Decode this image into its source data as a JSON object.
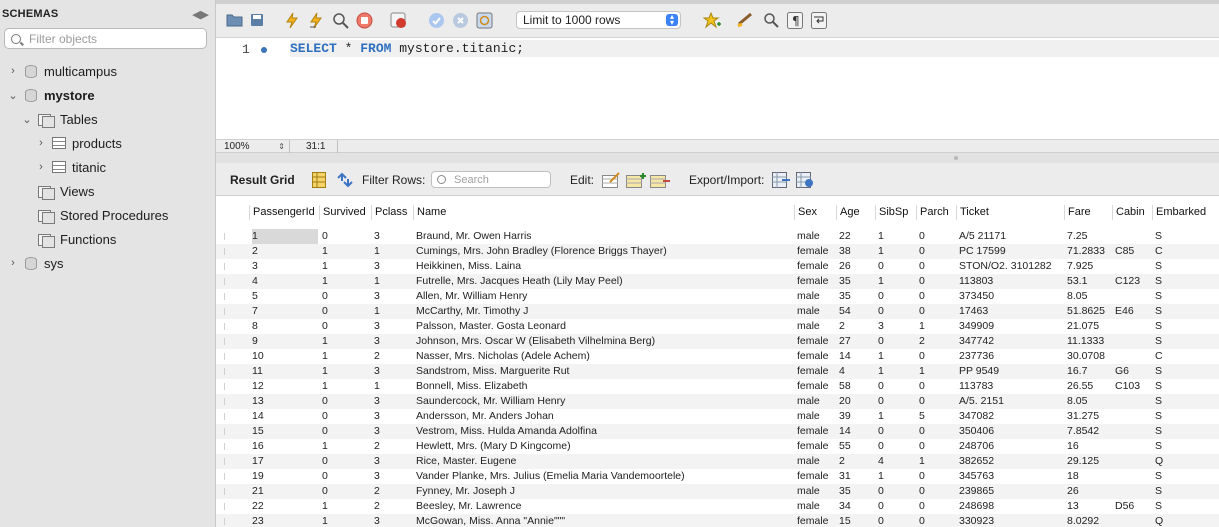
{
  "sidebar": {
    "title": "SCHEMAS",
    "search_placeholder": "Filter objects",
    "tree": [
      {
        "label": "multicampus",
        "chev": "›",
        "type": "db"
      },
      {
        "label": "mystore",
        "chev": "⌄",
        "type": "db"
      },
      {
        "label": "Tables",
        "chev": "⌄",
        "type": "folder"
      },
      {
        "label": "products",
        "chev": "›",
        "type": "table"
      },
      {
        "label": "titanic",
        "chev": "›",
        "type": "table"
      },
      {
        "label": "Views",
        "chev": "",
        "type": "folder"
      },
      {
        "label": "Stored Procedures",
        "chev": "",
        "type": "folder"
      },
      {
        "label": "Functions",
        "chev": "",
        "type": "folder"
      },
      {
        "label": "sys",
        "chev": "›",
        "type": "db"
      }
    ]
  },
  "toolbar": {
    "limit_label": "Limit to 1000 rows",
    "icons": [
      "open-folder-icon",
      "save-icon",
      "execute-icon",
      "execute-current-icon",
      "explain-icon",
      "stop-icon",
      "toggle-error-icon",
      "commit-icon",
      "rollback-icon",
      "autocommit-icon",
      "bookmark-icon",
      "beautify-icon",
      "find-icon",
      "invisible-chars-icon",
      "wrap-icon"
    ]
  },
  "editor": {
    "line_number": "1",
    "kw_select": "SELECT",
    "star": " * ",
    "kw_from": "FROM",
    "target": " mystore.titanic;"
  },
  "status": {
    "zoom": "100%",
    "cursor": "31:1"
  },
  "result_toolbar": {
    "result_grid_label": "Result Grid",
    "filter_label": "Filter Rows:",
    "search_placeholder": "Search",
    "edit_label": "Edit:",
    "export_label": "Export/Import:"
  },
  "grid": {
    "columns": [
      "PassengerId",
      "Survived",
      "Pclass",
      "Name",
      "Sex",
      "Age",
      "SibSp",
      "Parch",
      "Ticket",
      "Fare",
      "Cabin",
      "Embarked"
    ],
    "rows": [
      [
        "1",
        "0",
        "3",
        "Braund, Mr. Owen Harris",
        "male",
        "22",
        "1",
        "0",
        "A/5 21171",
        "7.25",
        "",
        "S"
      ],
      [
        "2",
        "1",
        "1",
        "Cumings, Mrs. John Bradley (Florence Briggs Thayer)",
        "female",
        "38",
        "1",
        "0",
        "PC 17599",
        "71.2833",
        "C85",
        "C"
      ],
      [
        "3",
        "1",
        "3",
        "Heikkinen, Miss. Laina",
        "female",
        "26",
        "0",
        "0",
        "STON/O2. 3101282",
        "7.925",
        "",
        "S"
      ],
      [
        "4",
        "1",
        "1",
        "Futrelle, Mrs. Jacques Heath (Lily May Peel)",
        "female",
        "35",
        "1",
        "0",
        "113803",
        "53.1",
        "C123",
        "S"
      ],
      [
        "5",
        "0",
        "3",
        "Allen, Mr. William Henry",
        "male",
        "35",
        "0",
        "0",
        "373450",
        "8.05",
        "",
        "S"
      ],
      [
        "7",
        "0",
        "1",
        "McCarthy, Mr. Timothy J",
        "male",
        "54",
        "0",
        "0",
        "17463",
        "51.8625",
        "E46",
        "S"
      ],
      [
        "8",
        "0",
        "3",
        "Palsson, Master. Gosta Leonard",
        "male",
        "2",
        "3",
        "1",
        "349909",
        "21.075",
        "",
        "S"
      ],
      [
        "9",
        "1",
        "3",
        "Johnson, Mrs. Oscar W (Elisabeth Vilhelmina Berg)",
        "female",
        "27",
        "0",
        "2",
        "347742",
        "11.1333",
        "",
        "S"
      ],
      [
        "10",
        "1",
        "2",
        "Nasser, Mrs. Nicholas (Adele Achem)",
        "female",
        "14",
        "1",
        "0",
        "237736",
        "30.0708",
        "",
        "C"
      ],
      [
        "11",
        "1",
        "3",
        "Sandstrom, Miss. Marguerite Rut",
        "female",
        "4",
        "1",
        "1",
        "PP 9549",
        "16.7",
        "G6",
        "S"
      ],
      [
        "12",
        "1",
        "1",
        "Bonnell, Miss. Elizabeth",
        "female",
        "58",
        "0",
        "0",
        "113783",
        "26.55",
        "C103",
        "S"
      ],
      [
        "13",
        "0",
        "3",
        "Saundercock, Mr. William Henry",
        "male",
        "20",
        "0",
        "0",
        "A/5. 2151",
        "8.05",
        "",
        "S"
      ],
      [
        "14",
        "0",
        "3",
        "Andersson, Mr. Anders Johan",
        "male",
        "39",
        "1",
        "5",
        "347082",
        "31.275",
        "",
        "S"
      ],
      [
        "15",
        "0",
        "3",
        "Vestrom, Miss. Hulda Amanda Adolfina",
        "female",
        "14",
        "0",
        "0",
        "350406",
        "7.8542",
        "",
        "S"
      ],
      [
        "16",
        "1",
        "2",
        "Hewlett, Mrs. (Mary D Kingcome)",
        "female",
        "55",
        "0",
        "0",
        "248706",
        "16",
        "",
        "S"
      ],
      [
        "17",
        "0",
        "3",
        "Rice, Master. Eugene",
        "male",
        "2",
        "4",
        "1",
        "382652",
        "29.125",
        "",
        "Q"
      ],
      [
        "19",
        "0",
        "3",
        "Vander Planke, Mrs. Julius (Emelia Maria Vandemoortele)",
        "female",
        "31",
        "1",
        "0",
        "345763",
        "18",
        "",
        "S"
      ],
      [
        "21",
        "0",
        "2",
        "Fynney, Mr. Joseph J",
        "male",
        "35",
        "0",
        "0",
        "239865",
        "26",
        "",
        "S"
      ],
      [
        "22",
        "1",
        "2",
        "Beesley, Mr. Lawrence",
        "male",
        "34",
        "0",
        "0",
        "248698",
        "13",
        "D56",
        "S"
      ],
      [
        "23",
        "1",
        "3",
        "McGowan, Miss. Anna \"Annie\"\"\"",
        "female",
        "15",
        "0",
        "0",
        "330923",
        "8.0292",
        "",
        "Q"
      ]
    ]
  }
}
